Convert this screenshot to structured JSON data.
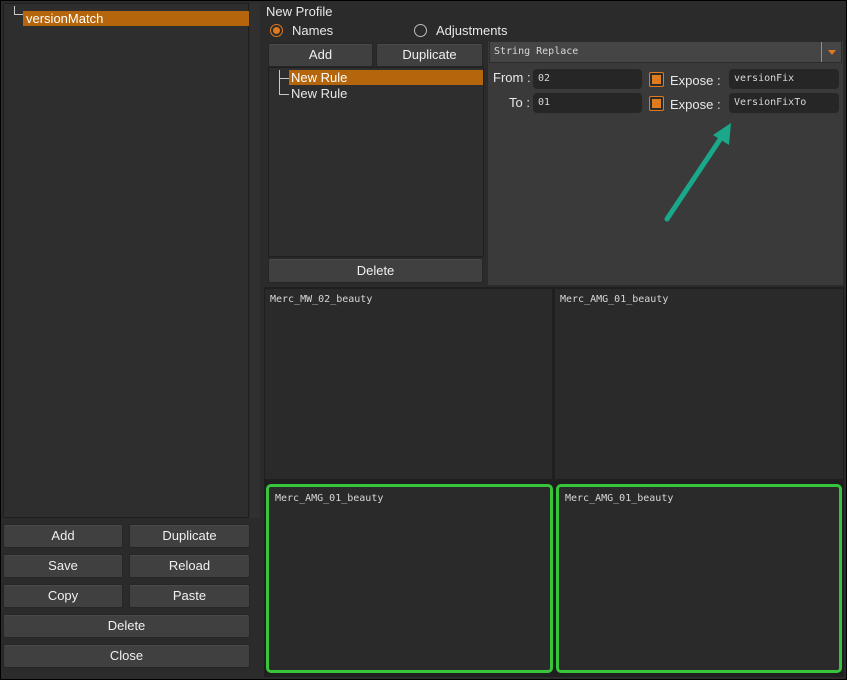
{
  "left_panel": {
    "tree_items": [
      {
        "label": "versionMatch",
        "selected": true
      }
    ],
    "buttons": {
      "add": "Add",
      "duplicate": "Duplicate",
      "save": "Save",
      "reload": "Reload",
      "copy": "Copy",
      "paste": "Paste",
      "delete": "Delete",
      "close": "Close"
    }
  },
  "profile": {
    "title": "New Profile",
    "modes": [
      {
        "label": "Names",
        "selected": true
      },
      {
        "label": "Adjustments",
        "selected": false
      }
    ]
  },
  "rules": {
    "add_label": "Add",
    "duplicate_label": "Duplicate",
    "delete_label": "Delete",
    "items": [
      {
        "label": "New Rule",
        "selected": true
      },
      {
        "label": "New Rule",
        "selected": false
      }
    ]
  },
  "rule_settings": {
    "type": "String Replace",
    "from_label": "From :",
    "from_value": "02",
    "to_label": "To :",
    "to_value": "01",
    "expose_label": "Expose :",
    "expose_from_checked": true,
    "expose_from_value": "versionFix",
    "expose_to_checked": true,
    "expose_to_value": "VersionFixTo"
  },
  "previews": [
    {
      "label": "Merc_MW_02_beauty",
      "highlighted": false
    },
    {
      "label": "Merc_AMG_01_beauty",
      "highlighted": false
    },
    {
      "label": "Merc_AMG_01_beauty",
      "highlighted": true
    },
    {
      "label": "Merc_AMG_01_beauty",
      "highlighted": true
    }
  ],
  "colors": {
    "accent": "#e07a1f",
    "selection": "#b5650b",
    "highlight": "#37c53c",
    "annotation_arrow": "#1aa88a"
  }
}
